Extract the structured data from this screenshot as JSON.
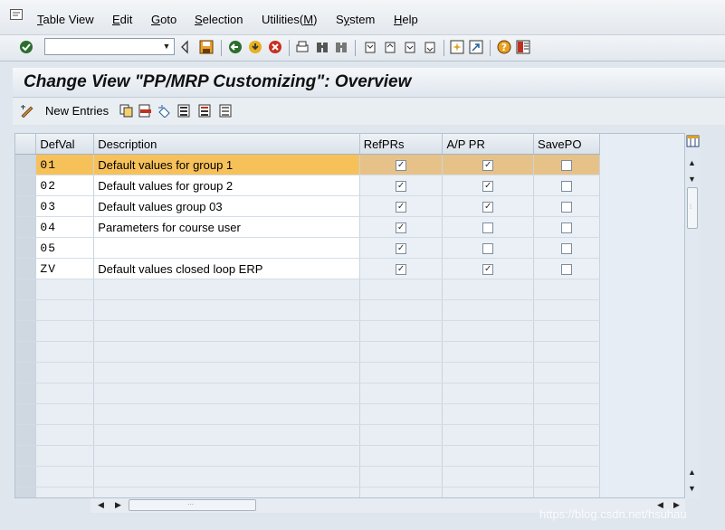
{
  "menu": {
    "items": [
      {
        "label": "Table View",
        "underline": "T"
      },
      {
        "label": "Edit",
        "underline": "E"
      },
      {
        "label": "Goto",
        "underline": "G"
      },
      {
        "label": "Selection",
        "underline": "S"
      },
      {
        "label": "Utilities(M)",
        "underline": "M"
      },
      {
        "label": "System",
        "underline": "y"
      },
      {
        "label": "Help",
        "underline": "H"
      }
    ]
  },
  "toolbar": {
    "command_value": "",
    "icons": [
      "enter-icon",
      "dropdown-icon",
      "back-triangle-icon",
      "save-icon",
      "back-icon",
      "exit-icon",
      "cancel-icon",
      "print-icon",
      "find-icon",
      "find-next-icon",
      "first-page-icon",
      "previous-page-icon",
      "next-page-icon",
      "last-page-icon",
      "create-session-icon",
      "shortcut-icon",
      "help-icon",
      "layout-icon"
    ]
  },
  "title": "Change View \"PP/MRP Customizing\": Overview",
  "app_toolbar": {
    "new_entries_label": "New Entries"
  },
  "table": {
    "columns": [
      "DefVal",
      "Description",
      "RefPRs",
      "A/P PR",
      "SavePO"
    ],
    "rows": [
      {
        "defval": "01",
        "description": "Default values for group 1",
        "refprs": true,
        "appr": true,
        "savepo": false,
        "highlight": true
      },
      {
        "defval": "02",
        "description": "Default values for group 2",
        "refprs": true,
        "appr": true,
        "savepo": false
      },
      {
        "defval": "03",
        "description": "Default values group 03",
        "refprs": true,
        "appr": true,
        "savepo": false
      },
      {
        "defval": "04",
        "description": "Parameters for course user",
        "refprs": true,
        "appr": false,
        "savepo": false
      },
      {
        "defval": "05",
        "description": "",
        "refprs": true,
        "appr": false,
        "savepo": false
      },
      {
        "defval": "ZV",
        "description": "Default values closed loop ERP",
        "refprs": true,
        "appr": true,
        "savepo": false
      }
    ],
    "empty_rows": 11
  },
  "watermark": "https://blog.csdn.net/hsuhau",
  "colors": {
    "highlight": "#f7c15a",
    "background": "#dfe6ed"
  }
}
